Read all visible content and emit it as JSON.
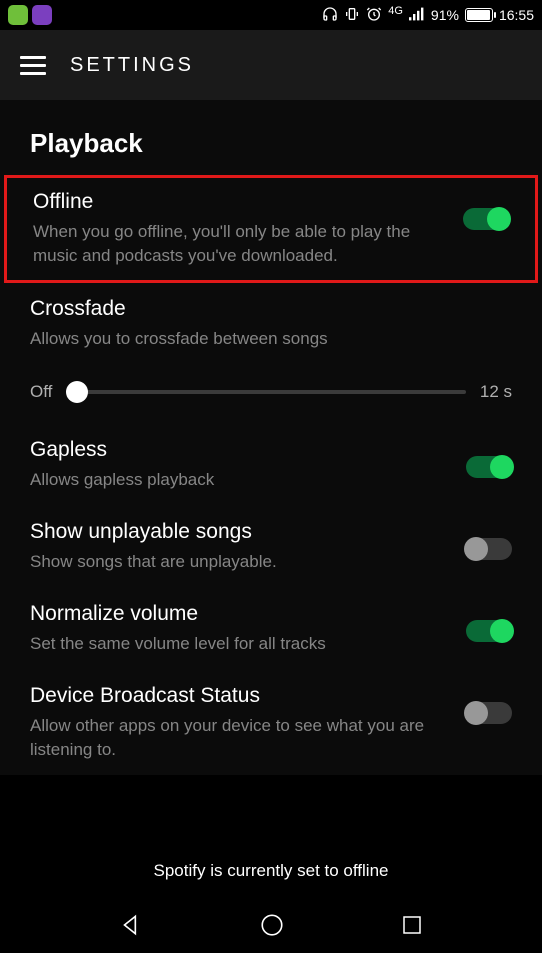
{
  "status_bar": {
    "battery_pct": "91%",
    "time": "16:55",
    "network_label": "4G"
  },
  "header": {
    "title": "SETTINGS"
  },
  "section": {
    "title": "Playback"
  },
  "settings": {
    "offline": {
      "label": "Offline",
      "desc": "When you go offline, you'll only be able to play the music and podcasts you've downloaded.",
      "on": true
    },
    "crossfade": {
      "label": "Crossfade",
      "desc": "Allows you to crossfade between songs",
      "slider_min_label": "Off",
      "slider_max_label": "12 s"
    },
    "gapless": {
      "label": "Gapless",
      "desc": "Allows gapless playback",
      "on": true
    },
    "unplayable": {
      "label": "Show unplayable songs",
      "desc": "Show songs that are unplayable.",
      "on": false
    },
    "normalize": {
      "label": "Normalize volume",
      "desc": "Set the same volume level for all tracks",
      "on": true
    },
    "broadcast": {
      "label": "Device Broadcast Status",
      "desc": "Allow other apps on your device to see what you are listening to.",
      "on": false
    }
  },
  "toast": "Spotify is currently set to offline"
}
